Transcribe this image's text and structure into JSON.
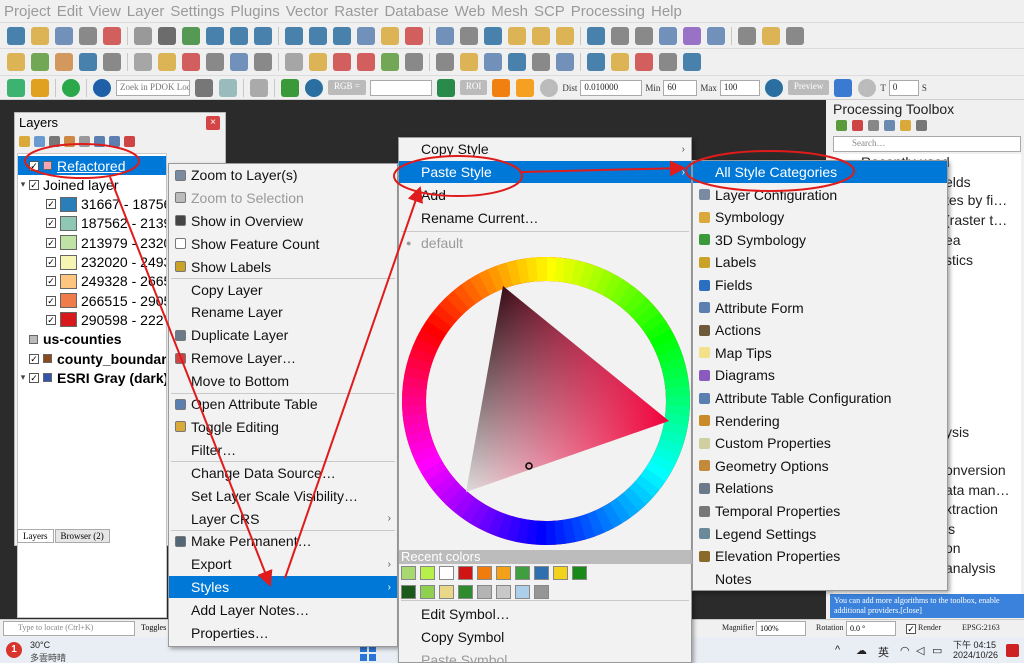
{
  "menubar": [
    "Project",
    "Edit",
    "View",
    "Layer",
    "Settings",
    "Plugins",
    "Vector",
    "Raster",
    "Database",
    "Web",
    "Mesh",
    "SCP",
    "Processing",
    "Help"
  ],
  "toolbar3": {
    "zoom_placeholder": "Zoek in PDOK Loc···",
    "rgb_label": "RGB =",
    "roi_label": "ROI",
    "dist_label": "Dist",
    "dist_value": "0.010000",
    "min_label": "Min",
    "min_value": "60",
    "max_label": "Max",
    "max_value": "100",
    "preview_label": "Preview",
    "t_label": "T",
    "t_value": "0",
    "s_label": "S"
  },
  "layers_panel": {
    "title": "Layers",
    "close": "×",
    "tabs": [
      "Layers",
      "Browser (2)"
    ],
    "items": [
      {
        "label": "Refactored",
        "indent": 0,
        "selected": true,
        "arrow": "",
        "swatch": "#f4a6b5"
      },
      {
        "label": "Joined layer",
        "indent": 0,
        "arrow": "▾",
        "swatch": ""
      },
      {
        "label": "31667 - 18756",
        "indent": 1,
        "swatch": "#2a7fb8"
      },
      {
        "label": "187562 - 2139",
        "indent": 1,
        "swatch": "#8fc7b5"
      },
      {
        "label": "213979 - 2320",
        "indent": 1,
        "swatch": "#bfe3a4"
      },
      {
        "label": "232020 - 2493",
        "indent": 1,
        "swatch": "#f7f5b3"
      },
      {
        "label": "249328 - 2665",
        "indent": 1,
        "swatch": "#fdc57f"
      },
      {
        "label": "266515 - 2905",
        "indent": 1,
        "swatch": "#f07b4b"
      },
      {
        "label": "290598 - 2227",
        "indent": 1,
        "swatch": "#d7191c"
      },
      {
        "label": "us-counties",
        "indent": 0,
        "arrow": "",
        "swatch": "#bbbbbb",
        "bold": true,
        "nocb": true
      },
      {
        "label": "county_boundar",
        "indent": 0,
        "arrow": "",
        "swatch": "#8a4a1c",
        "bold": true
      },
      {
        "label": "ESRI Gray (dark)",
        "indent": 0,
        "arrow": "▾",
        "swatch": "#3355aa",
        "bold": true
      }
    ]
  },
  "context_menu": [
    {
      "label": "Zoom to Layer(s)",
      "icon": "#7a8aa0"
    },
    {
      "label": "Zoom to Selection",
      "disabled": true,
      "icon": "#bbbbbb"
    },
    {
      "label": "Show in Overview",
      "icon": "#444444"
    },
    {
      "label": "Show Feature Count",
      "icon": "#ffffff"
    },
    {
      "label": "Show Labels",
      "icon": "#c9a227"
    },
    {
      "label": "Copy Layer",
      "icon": ""
    },
    {
      "label": "Rename Layer",
      "icon": ""
    },
    {
      "label": "Duplicate Layer",
      "icon": "#6a7a8a"
    },
    {
      "label": "Remove Layer…",
      "icon": "#c44"
    },
    {
      "label": "Move to Bottom",
      "icon": ""
    },
    {
      "label": "Open Attribute Table",
      "icon": "#5a7fb0"
    },
    {
      "label": "Toggle Editing",
      "icon": "#d9a93a"
    },
    {
      "label": "Filter…",
      "icon": ""
    },
    {
      "label": "Change Data Source…",
      "icon": ""
    },
    {
      "label": "Set Layer Scale Visibility…",
      "icon": ""
    },
    {
      "label": "Layer CRS",
      "icon": "",
      "submenu": true
    },
    {
      "label": "Make Permanent…",
      "icon": "#556677"
    },
    {
      "label": "Export",
      "icon": "",
      "submenu": true
    },
    {
      "label": "Styles",
      "icon": "",
      "submenu": true,
      "selected": true
    },
    {
      "label": "Add Layer Notes…",
      "icon": ""
    },
    {
      "label": "Properties…",
      "icon": ""
    }
  ],
  "styles_menu": {
    "copy_style": "Copy Style",
    "paste_style": "Paste Style",
    "add": "Add",
    "rename_current": "Rename Current…",
    "default": "default",
    "recent_colors_label": "Recent colors",
    "recent_colors": [
      "#a8d870",
      "#b7f04a",
      "#ffffff",
      "#d01515",
      "#f07c0d",
      "#f4a018",
      "#3f9f3f",
      "#2f6fb0",
      "#f2d21a",
      "#178a17",
      "#1b5a1b",
      "#90d050",
      "#e8d888",
      "#2e8b2e",
      "#b4b4b4",
      "#c8c8c8",
      "#aecfea",
      "#969696"
    ],
    "edit_symbol": "Edit Symbol…",
    "copy_symbol": "Copy Symbol",
    "paste_symbol": "Paste Symbol"
  },
  "categories_menu": [
    {
      "label": "All Style Categories",
      "selected": true,
      "icon": ""
    },
    {
      "label": "Layer Configuration",
      "icon": "#7a8aa0"
    },
    {
      "label": "Symbology",
      "icon": "#d9a93a"
    },
    {
      "label": "3D Symbology",
      "icon": "#3a9a3a"
    },
    {
      "label": "Labels",
      "icon": "#c9a227"
    },
    {
      "label": "Fields",
      "icon": "#2a6fc0"
    },
    {
      "label": "Attribute Form",
      "icon": "#5a7fb0"
    },
    {
      "label": "Actions",
      "icon": "#6d5a3a"
    },
    {
      "label": "Map Tips",
      "icon": "#f2e08a"
    },
    {
      "label": "Diagrams",
      "icon": "#8a5abf"
    },
    {
      "label": "Attribute Table Configuration",
      "icon": "#5a7fb0"
    },
    {
      "label": "Rendering",
      "icon": "#c98a2a"
    },
    {
      "label": "Custom Properties",
      "icon": "#cfcf9f"
    },
    {
      "label": "Geometry Options",
      "icon": "#c48a3a"
    },
    {
      "label": "Relations",
      "icon": "#6a7a8a"
    },
    {
      "label": "Temporal Properties",
      "icon": "#777777"
    },
    {
      "label": "Legend Settings",
      "icon": "#6a8a9a"
    },
    {
      "label": "Elevation Properties",
      "icon": "#8a6a2a"
    },
    {
      "label": "Notes",
      "icon": ""
    }
  ],
  "processing_toolbox": {
    "title": "Processing Toolbox",
    "search_placeholder": "Search…",
    "visible_fragments": [
      "Recently used",
      "elds",
      "tes by fi…",
      "(raster t…",
      "ea",
      "stics",
      "ysis",
      "onversion",
      "ata man…",
      "xtraction",
      "is",
      "on",
      "analysis"
    ],
    "note": "You can add more algorithms to the toolbox, enable additional providers.[close]"
  },
  "statusbar": {
    "locate_placeholder": "Type to locate (Ctrl+K)",
    "toggles": "Toggles t",
    "magnifier_label": "Magnifier",
    "magnifier_value": "100%",
    "rotation_label": "Rotation",
    "rotation_value": "0.0 °",
    "render_label": "Render",
    "epsg": "EPSG:2163"
  },
  "taskbar": {
    "temp": "30°C",
    "weather": "多雲時晴",
    "ime": "英",
    "time": "下午 04:15",
    "date": "2024/10/26"
  }
}
